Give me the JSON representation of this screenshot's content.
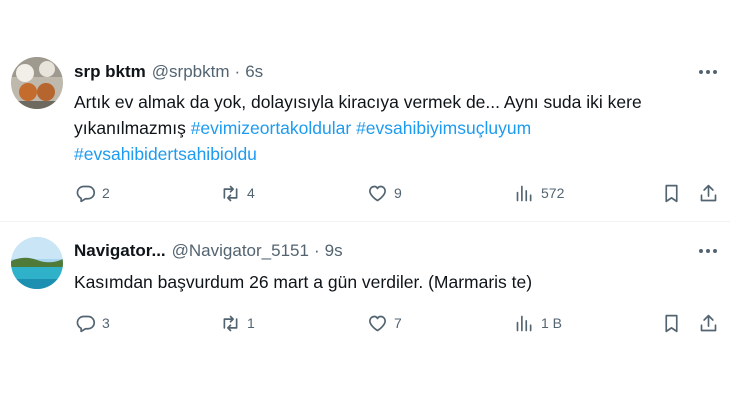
{
  "tweets": [
    {
      "author": {
        "name": "srp bktm",
        "handle": "@srpbktm",
        "time": "6s",
        "avatar_icon": "avatar-image"
      },
      "text_plain": "Artık ev almak da yok, dolayısıyla kiracıya vermek de... Aynı suda iki kere yıkanılmazmış ",
      "hashtags": [
        "#evimizeortakoldular",
        "#evsahibiyimsuçluyum",
        "#evsahibidertsahibioldu"
      ],
      "stats": {
        "replies": "2",
        "reposts": "4",
        "likes": "9",
        "views": "572"
      }
    },
    {
      "author": {
        "name": "Navigator...",
        "handle": "@Navigator_5151",
        "time": "9s",
        "avatar_icon": "avatar-image"
      },
      "text_plain": "Kasımdan başvurdum 26 mart a gün verdiler. (Marmaris te)",
      "hashtags": [],
      "stats": {
        "replies": "3",
        "reposts": "1",
        "likes": "7",
        "views": "1 B"
      }
    }
  ],
  "icons": {
    "more": "more-icon",
    "reply": "reply-icon",
    "repost": "repost-icon",
    "like": "like-icon",
    "views": "views-icon",
    "bookmark": "bookmark-icon",
    "share": "share-icon"
  },
  "colors": {
    "text": "#0f1419",
    "secondary": "#536471",
    "link": "#1d9bf0",
    "divider": "#eff3f4"
  }
}
